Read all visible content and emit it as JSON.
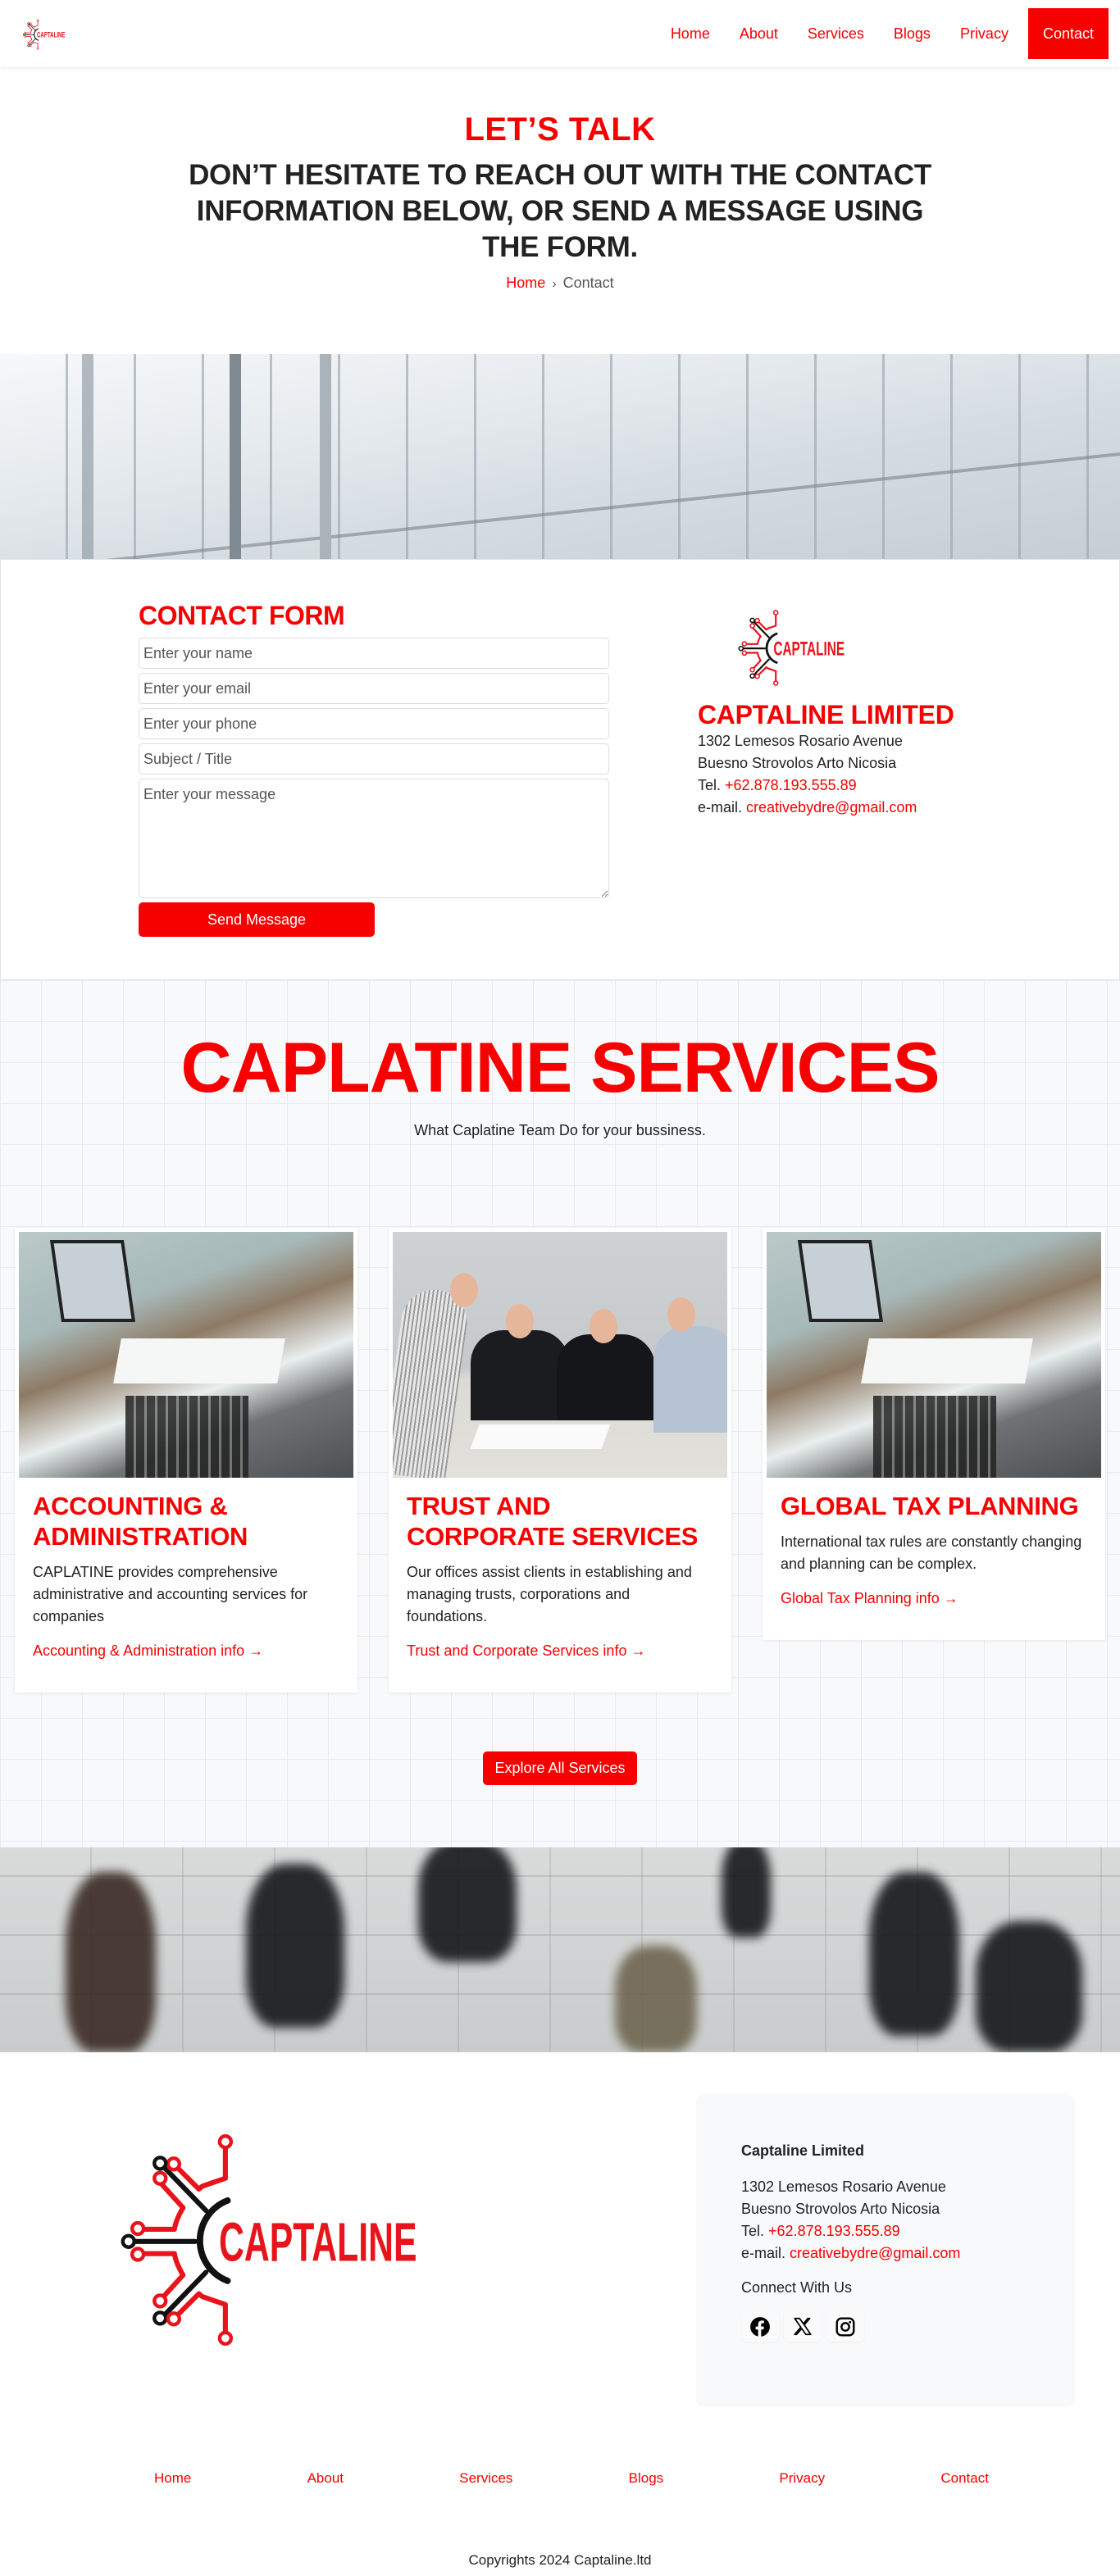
{
  "brand": {
    "logo_text": "CAPTALINE",
    "accent_color": "#f70000"
  },
  "header": {
    "nav": [
      {
        "label": "Home",
        "active": false
      },
      {
        "label": "About",
        "active": false
      },
      {
        "label": "Services",
        "active": false
      },
      {
        "label": "Blogs",
        "active": false
      },
      {
        "label": "Privacy",
        "active": false
      },
      {
        "label": "Contact",
        "active": true
      }
    ]
  },
  "hero": {
    "kicker": "LET’S TALK",
    "title": "DON’T HESITATE TO REACH OUT WITH THE CONTACT INFORMATION BELOW, OR SEND A MESSAGE USING THE FORM.",
    "breadcrumb": {
      "home": "Home",
      "separator": "›",
      "current": "Contact"
    }
  },
  "contact_form": {
    "title": "CONTACT FORM",
    "fields": {
      "name_placeholder": "Enter your name",
      "email_placeholder": "Enter your email",
      "phone_placeholder": "Enter your phone",
      "subject_placeholder": "Subject / Title",
      "message_placeholder": "Enter your message"
    },
    "submit_label": "Send Message"
  },
  "contact_info": {
    "company": "CAPTALINE LIMITED",
    "address_line1": "1302 Lemesos Rosario Avenue",
    "address_line2": "Buesno Strovolos Arto Nicosia",
    "tel_label": "Tel.",
    "tel": "+62.878.193.555.89",
    "email_label": "e-mail.",
    "email": "creativebydre@gmail.com"
  },
  "services": {
    "title": "CAPLATINE SERVICES",
    "subtitle": "What Caplatine Team Do for your bussiness.",
    "cards": [
      {
        "title": "ACCOUNTING & ADMINISTRATION",
        "description": "CAPLATINE provides comprehensive administrative and accounting services for companies",
        "link": "Accounting & Administration info →",
        "image": "laptop-desk-photo"
      },
      {
        "title": "TRUST AND CORPORATE SERVICES",
        "description": "Our offices assist clients in establishing and managing trusts, corporations and foundations.",
        "link": "Trust and Corporate Services info →",
        "image": "business-meeting-photo"
      },
      {
        "title": "GLOBAL TAX PLANNING",
        "description": "International tax rules are constantly changing and planning can be complex.",
        "link": "Global Tax Planning info →",
        "image": "laptop-desk-photo"
      }
    ],
    "explore_label": "Explore All Services"
  },
  "footer": {
    "company": "Captaline Limited",
    "address_line1": "1302 Lemesos Rosario Avenue",
    "address_line2": "Buesno Strovolos Arto Nicosia",
    "tel_label": "Tel.",
    "tel": "+62.878.193.555.89",
    "email_label": "e-mail.",
    "email": "creativebydre@gmail.com",
    "connect_label": "Connect With Us",
    "socials": [
      "facebook-icon",
      "x-icon",
      "instagram-icon"
    ],
    "nav": [
      "Home",
      "About",
      "Services",
      "Blogs",
      "Privacy",
      "Contact"
    ],
    "copyright": "Copyrights 2024 Captaline.ltd"
  }
}
